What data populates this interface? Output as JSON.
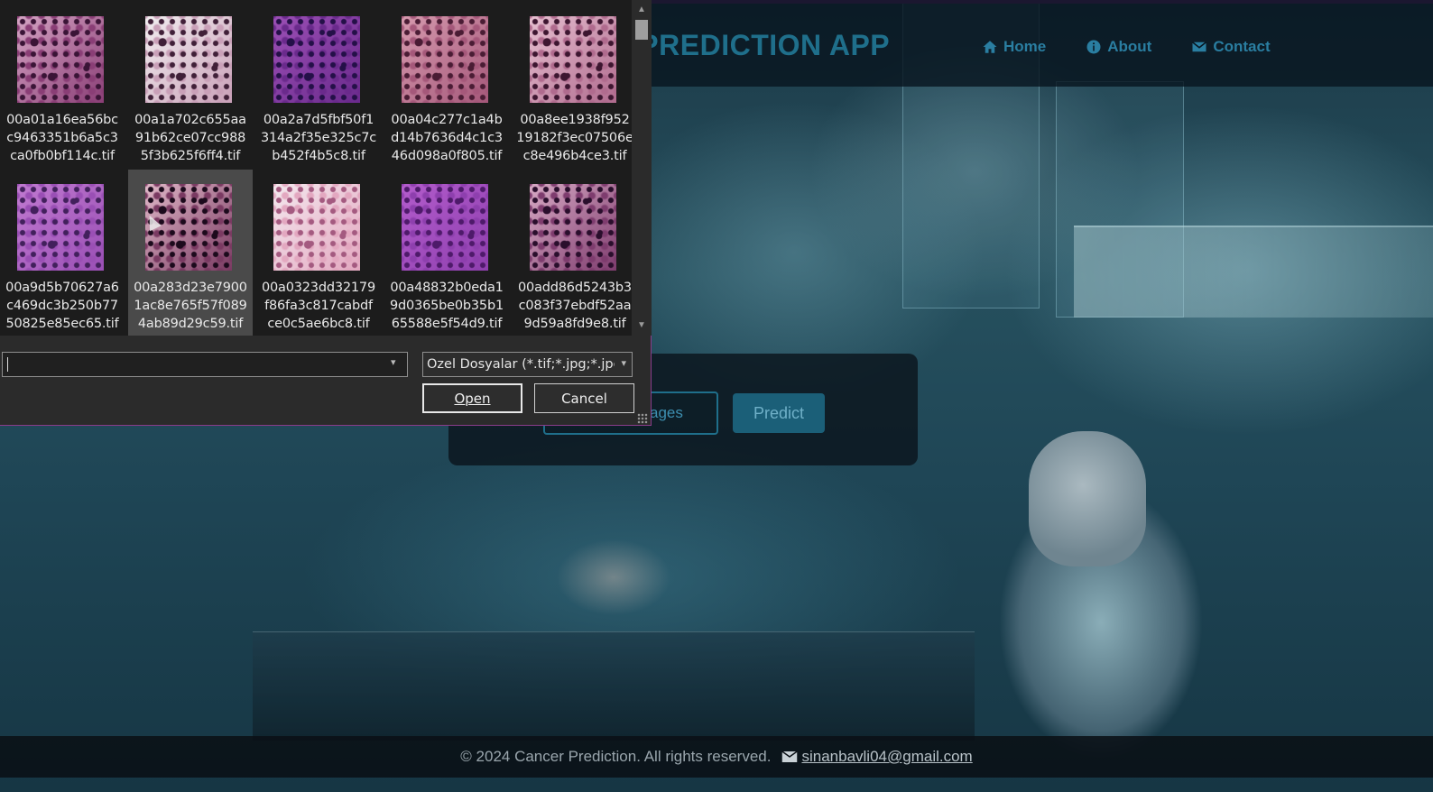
{
  "app": {
    "title": "CANCER PREDICTION APP",
    "nav": [
      {
        "label": "Home",
        "icon": "home-icon"
      },
      {
        "label": "About",
        "icon": "info-icon"
      },
      {
        "label": "Contact",
        "icon": "envelope-icon"
      }
    ],
    "upload_label": "Images",
    "predict_label": "Predict",
    "footer": {
      "copyright": "© 2024 Cancer Prediction. All rights reserved.",
      "email": "sinanbavli04@gmail.com",
      "email_icon": "envelope-icon"
    },
    "colors": {
      "accent": "#1f6f8b",
      "button": "#1b5f78",
      "header_bg": "#08141e"
    }
  },
  "dialog": {
    "files": [
      {
        "lines": [
          "00a01a16ea56bc",
          "c9463351b6a5c3",
          "ca0fb0bf114c.tif"
        ],
        "colors": [
          "#d4a3c3",
          "#8a3e76",
          "#3a1436"
        ],
        "selected": false
      },
      {
        "lines": [
          "00a1a702c655aa",
          "91b62ce07cc988",
          "5f3b625f6ff4.tif"
        ],
        "colors": [
          "#f2eef0",
          "#c9a0b8",
          "#402038"
        ],
        "selected": false
      },
      {
        "lines": [
          "00a2a7d5fbf50f1",
          "314a2f35e325c7c",
          "b452f4b5c8.tif"
        ],
        "colors": [
          "#9b4fb5",
          "#6a2a8c",
          "#241048"
        ],
        "selected": false
      },
      {
        "lines": [
          "00a04c277c1a4b",
          "d14b7636d4c1c3",
          "46d098a0f805.tif"
        ],
        "colors": [
          "#d69aae",
          "#a5587a",
          "#4a1c34"
        ],
        "selected": false
      },
      {
        "lines": [
          "00a8ee1938f952",
          "19182f3ec07506e",
          "c8e496b4ce3.tif"
        ],
        "colors": [
          "#e6bfd0",
          "#b06b8e",
          "#3d1630"
        ],
        "selected": false
      },
      {
        "lines": [
          "00a9d5b70627a6",
          "c469dc3b250b77",
          "50825e85ec65.tif"
        ],
        "colors": [
          "#c07ad0",
          "#9a4fb5",
          "#42205c"
        ],
        "selected": false
      },
      {
        "lines": [
          "00a283d23e7900",
          "1ac8e765f57f089",
          "4ab89d29c59.tif"
        ],
        "colors": [
          "#e0b8c8",
          "#7a3a62",
          "#1c0a1c"
        ],
        "selected": true
      },
      {
        "lines": [
          "00a0323dd32179",
          "f86fa3c817cabdf",
          "ce0c5ae6bc8.tif"
        ],
        "colors": [
          "#f4e8ee",
          "#e3a8c0",
          "#a45a80"
        ],
        "selected": false
      },
      {
        "lines": [
          "00a48832b0eda1",
          "9d0365be0b35b1",
          "65588e5f54d9.tif"
        ],
        "colors": [
          "#b35ccc",
          "#8e3fae",
          "#4e1a6a"
        ],
        "selected": false
      },
      {
        "lines": [
          "00add86d5243b3",
          "c083f37ebdf52aa",
          "9d59a8fd9e8.tif"
        ],
        "colors": [
          "#d7a9c4",
          "#7e3c6e",
          "#2a0e2c"
        ],
        "selected": false
      }
    ],
    "filename_value": "",
    "filetype": "Özel Dosyalar (*.tif;*.jpg;*.jpeg;*.png)",
    "open_label": "Open",
    "cancel_label": "Cancel"
  }
}
